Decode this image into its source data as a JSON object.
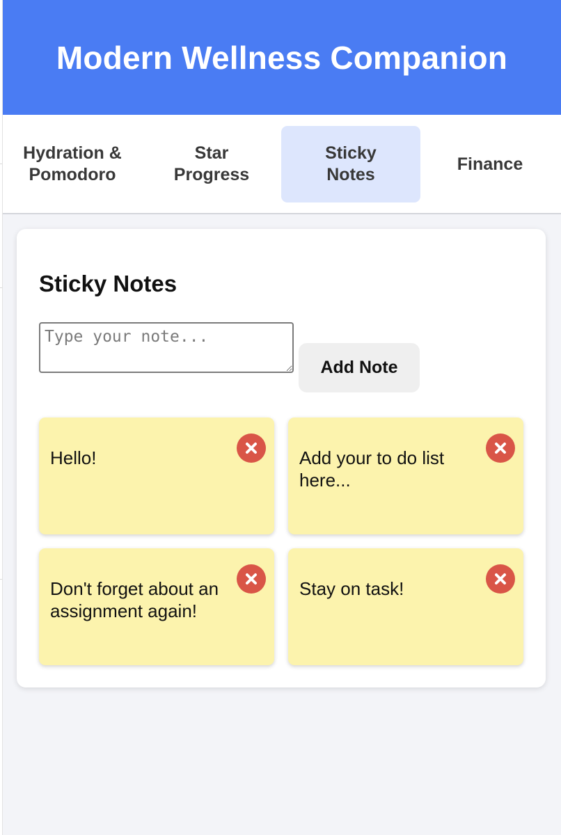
{
  "app": {
    "title": "Modern Wellness Companion"
  },
  "tabs": [
    {
      "label": "Hydration &\nPomodoro",
      "active": false
    },
    {
      "label": "Star\nProgress",
      "active": false
    },
    {
      "label": "Sticky\nNotes",
      "active": true
    },
    {
      "label": "Finance",
      "active": false
    }
  ],
  "sticky": {
    "heading": "Sticky Notes",
    "input_placeholder": "Type your note...",
    "input_value": "",
    "add_label": "Add Note",
    "notes": [
      {
        "text": "Hello!"
      },
      {
        "text": "Add your to do list here..."
      },
      {
        "text": "Don't forget about an assignment again!"
      },
      {
        "text": "Stay on task!"
      }
    ]
  },
  "colors": {
    "header": "#4a7cf3",
    "active_tab": "#dde6fd",
    "note": "#fcf3ad",
    "delete": "#d95547"
  },
  "icons": {
    "delete": "close-x-icon"
  }
}
